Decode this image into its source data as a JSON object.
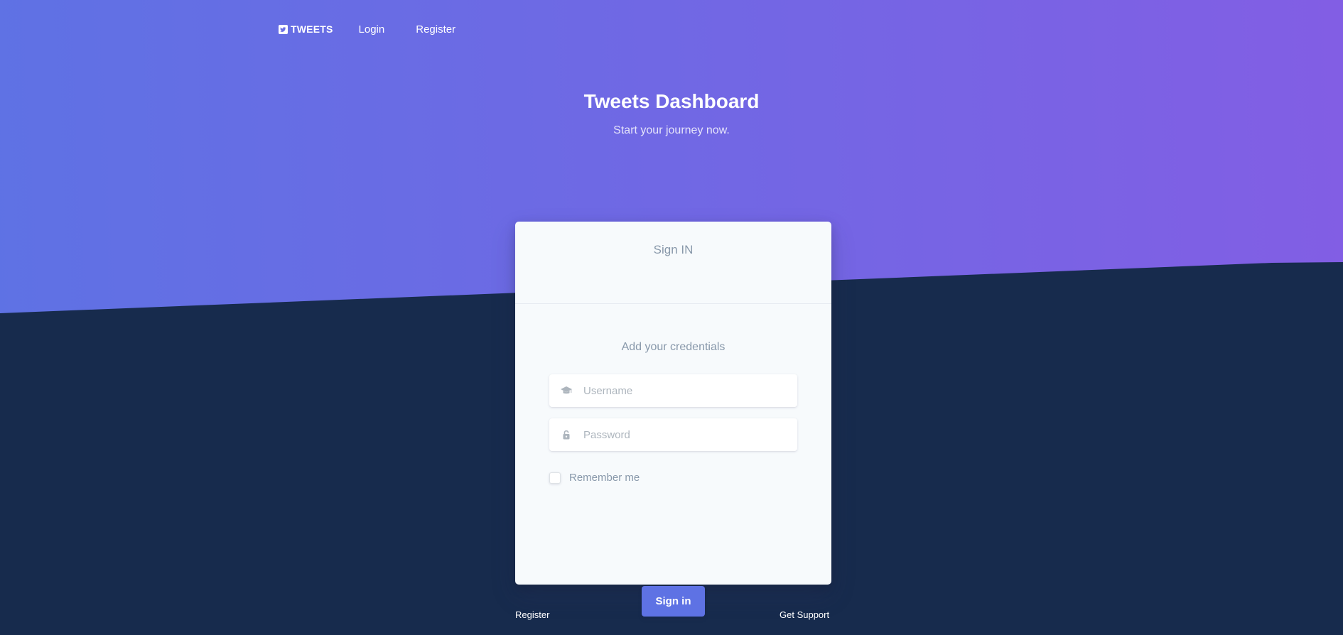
{
  "navbar": {
    "brand_label": "TWEETS",
    "login_label": "Login",
    "register_label": "Register"
  },
  "hero": {
    "title": "Tweets Dashboard",
    "subtitle": "Start your journey now."
  },
  "card": {
    "header": "Sign IN",
    "credentials_text": "Add your credentials",
    "username": {
      "value": "",
      "placeholder": "Username",
      "icon": "graduation-cap-icon"
    },
    "password": {
      "value": "",
      "placeholder": "Password",
      "icon": "lock-icon"
    },
    "remember_label": "Remember me",
    "remember_checked": false,
    "signin_label": "Sign in"
  },
  "footer": {
    "register_label": "Register",
    "support_label": "Get Support"
  },
  "colors": {
    "gradient_start": "#5e72e4",
    "gradient_end": "#825ee4",
    "background_dark": "#172b4d",
    "primary_button": "#5e72e4",
    "card_background": "#f7fafc",
    "muted_text": "#8898aa"
  }
}
